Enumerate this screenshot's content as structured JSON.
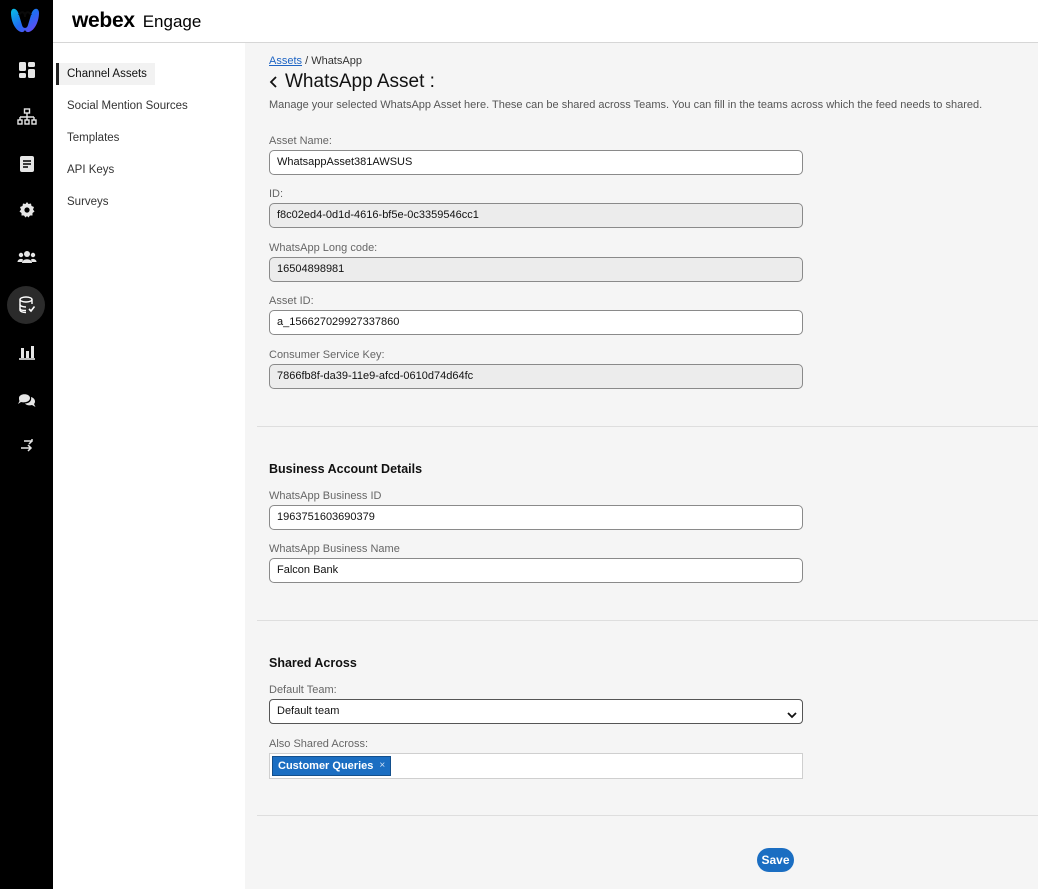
{
  "app": {
    "brand_main": "webex",
    "brand_sub": "Engage"
  },
  "rail": {
    "icons": [
      "dashboard-icon",
      "hierarchy-icon",
      "document-icon",
      "gear-icon",
      "people-icon",
      "database-icon",
      "bar-chart-icon",
      "chat-icon",
      "export-icon"
    ],
    "active": "database-icon"
  },
  "sidebar": {
    "items": [
      {
        "label": "Channel Assets"
      },
      {
        "label": "Social Mention Sources"
      },
      {
        "label": "Templates"
      },
      {
        "label": "API Keys"
      },
      {
        "label": "Surveys"
      }
    ]
  },
  "breadcrumb": {
    "parent": "Assets",
    "separator": " / ",
    "current": "WhatsApp"
  },
  "page": {
    "title": "WhatsApp Asset :",
    "description": "Manage your selected WhatsApp Asset here. These can be shared across Teams. You can fill in the teams across which the feed needs to shared."
  },
  "asset": {
    "name_label": "Asset Name:",
    "name_value": "WhatsappAsset381AWSUS",
    "id_label": "ID:",
    "id_value": "f8c02ed4-0d1d-4616-bf5e-0c3359546cc1",
    "long_code_label": "WhatsApp Long code:",
    "long_code_value": "16504898981",
    "asset_id_label": "Asset ID:",
    "asset_id_value": "a_156627029927337860",
    "consumer_key_label": "Consumer Service Key:",
    "consumer_key_value": "7866fb8f-da39-11e9-afcd-0610d74d64fc"
  },
  "business": {
    "section_title": "Business Account Details",
    "id_label": "WhatsApp Business ID",
    "id_value": "1963751603690379",
    "name_label": "WhatsApp Business Name",
    "name_value": "Falcon Bank"
  },
  "shared": {
    "section_title": "Shared Across",
    "default_team_label": "Default Team:",
    "default_team_value": "Default team",
    "also_label": "Also Shared Across:",
    "chips": [
      {
        "label": "Customer Queries",
        "remove": "×"
      }
    ]
  },
  "actions": {
    "save_label": "Save"
  },
  "colors": {
    "accent": "#1b6ec2",
    "link": "#1d64c4",
    "rail": "#000000"
  }
}
